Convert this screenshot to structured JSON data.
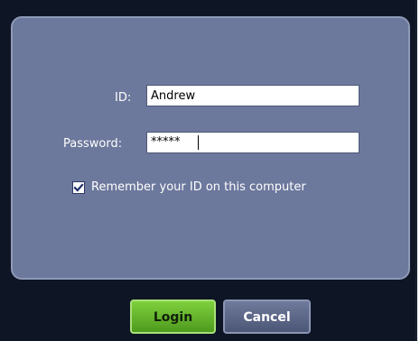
{
  "login": {
    "id_label": "ID:",
    "id_value": "Andrew",
    "password_label": "Password:",
    "password_value": "*****",
    "remember_label": "Remember your ID on this computer",
    "remember_checked": true,
    "login_button": "Login",
    "cancel_button": "Cancel"
  },
  "icons": {
    "checkbox": "check-icon"
  },
  "colors": {
    "background": "#0e1525",
    "panel": "#6c789c",
    "login_button": "#5fae2a",
    "cancel_button": "#5a6486"
  }
}
